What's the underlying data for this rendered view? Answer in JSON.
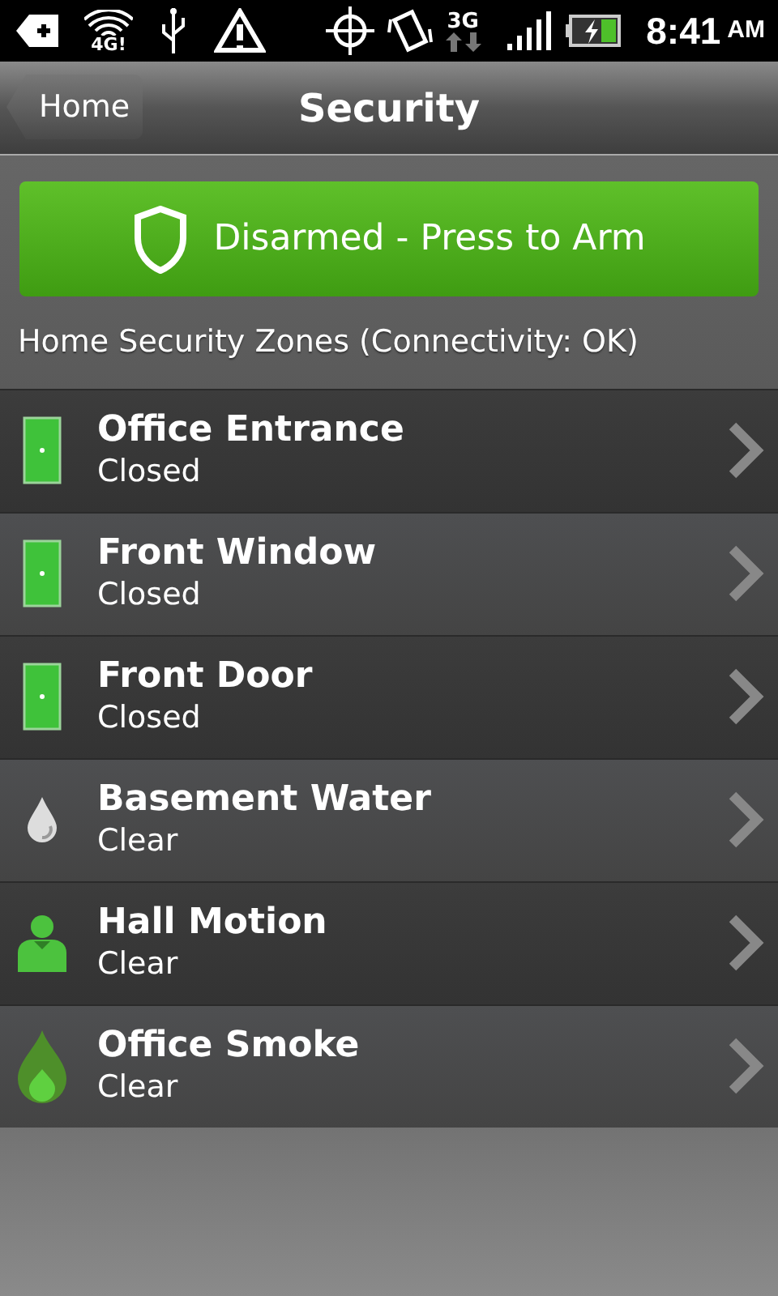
{
  "status_bar": {
    "wifi_label": "4G!",
    "network_label": "3G",
    "time": "8:41",
    "meridiem": "AM"
  },
  "title_bar": {
    "back_button": "Home",
    "title": "Security"
  },
  "arm_button": {
    "label": "Disarmed - Press to Arm"
  },
  "zones_heading": "Home Security Zones (Connectivity: OK)",
  "zones": [
    {
      "kind": "door",
      "name": "Office Entrance",
      "status": "Closed"
    },
    {
      "kind": "door",
      "name": "Front Window",
      "status": "Closed"
    },
    {
      "kind": "door",
      "name": "Front Door",
      "status": "Closed"
    },
    {
      "kind": "water",
      "name": "Basement Water",
      "status": "Clear"
    },
    {
      "kind": "motion",
      "name": "Hall Motion",
      "status": "Clear"
    },
    {
      "kind": "smoke",
      "name": "Office Smoke",
      "status": "Clear"
    }
  ]
}
